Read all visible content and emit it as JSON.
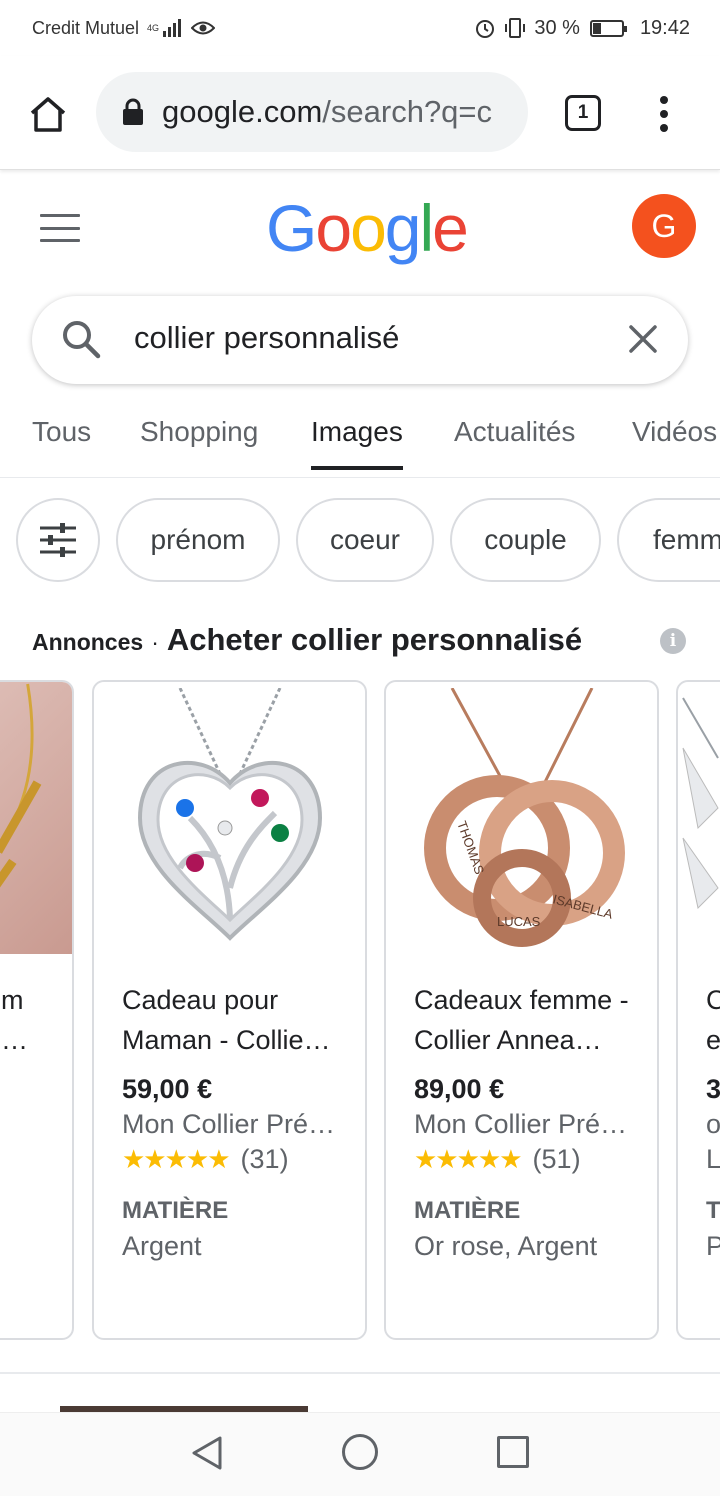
{
  "status_bar": {
    "carrier": "Credit Mutuel",
    "network": "4G",
    "battery": "30 %",
    "battery_level": 0.3,
    "time": "19:42"
  },
  "browser": {
    "url_domain": "google.com",
    "url_rest": "/search?q=c",
    "tab_count": "1"
  },
  "google": {
    "logo_letters": [
      "G",
      "o",
      "o",
      "g",
      "l",
      "e"
    ],
    "logo_colors": [
      "#4285F4",
      "#EA4335",
      "#FBBC05",
      "#4285F4",
      "#34A853",
      "#EA4335"
    ],
    "avatar_letter": "G",
    "avatar_color": "#f4511e"
  },
  "search": {
    "query": "collier personnalisé"
  },
  "nav_tabs": [
    {
      "label": "Tous",
      "active": false
    },
    {
      "label": "Shopping",
      "active": false
    },
    {
      "label": "Images",
      "active": true
    },
    {
      "label": "Actualités",
      "active": false
    },
    {
      "label": "Vidéos",
      "active": false
    }
  ],
  "chips": [
    "prénom",
    "coeur",
    "couple",
    "femme"
  ],
  "ads": {
    "label": "Annonces",
    "title": "Acheter collier personnalisé"
  },
  "products": [
    {
      "title": "Cadeau pour Maman - Collie…",
      "price": "59,00 €",
      "merchant": "Mon Collier Pré…",
      "stars": "★★★★★",
      "rating_value": 5,
      "reviews": "(31)",
      "attr_label": "MATIÈRE",
      "attr_value": "Argent"
    },
    {
      "title": "Cadeaux femme - Collier Annea…",
      "price": "89,00 €",
      "merchant": "Mon Collier Pré…",
      "stars": "★★★★★",
      "rating_value": 4.5,
      "reviews": "(51)",
      "attr_label": "MATIÈRE",
      "attr_value": "Or rose, Argent"
    }
  ],
  "partial_left_card": {
    "title_lines": [
      "m",
      "…"
    ]
  },
  "partial_right_card": {
    "title_lines": [
      "C",
      "e"
    ],
    "price_start": "3",
    "merchant_start": "o",
    "rating_start": "L",
    "attr_label_start": "T",
    "attr_value_start": "P"
  }
}
